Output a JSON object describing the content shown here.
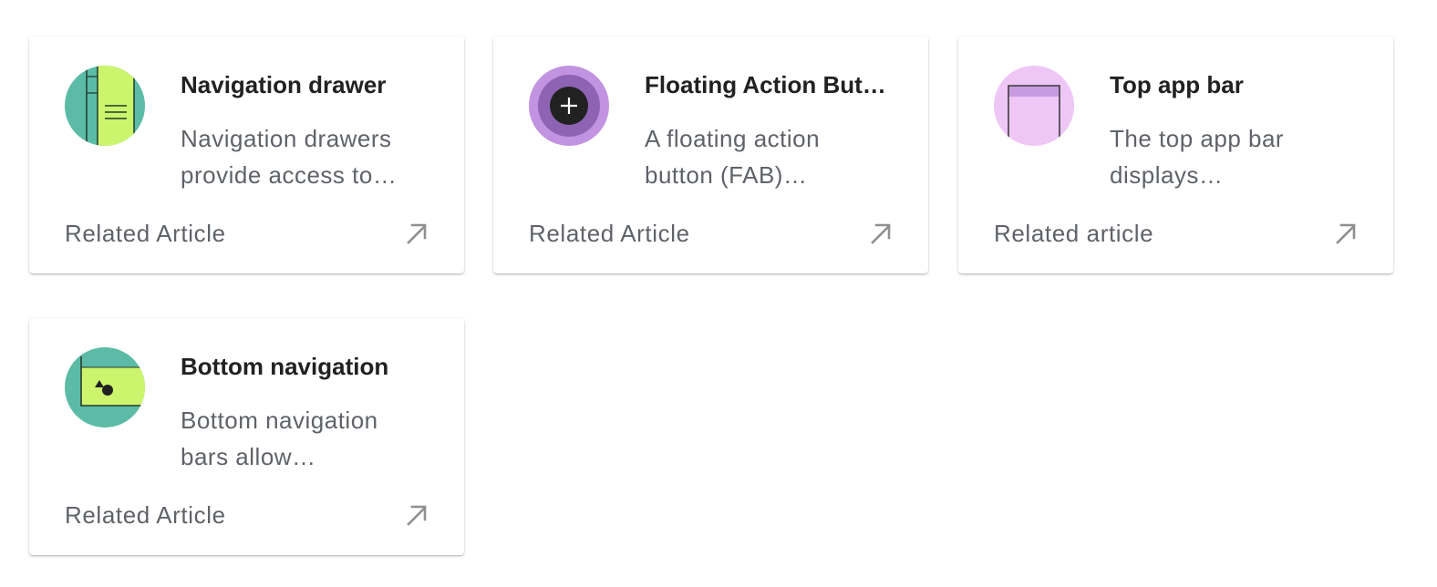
{
  "cards": [
    {
      "title": "Navigation drawer",
      "description": "Navigation drawers\nprovide access to…",
      "link_label": "Related Article",
      "icon": "navigation-drawer-thumbnail"
    },
    {
      "title": "Floating Action But…",
      "description": "A floating action\nbutton (FAB)…",
      "link_label": "Related Article",
      "icon": "fab-thumbnail"
    },
    {
      "title": "Top app bar",
      "description": "The top app bar\ndisplays…",
      "link_label": "Related article",
      "icon": "top-app-bar-thumbnail"
    },
    {
      "title": "Bottom navigation",
      "description": "Bottom navigation\nbars allow…",
      "link_label": "Related Article",
      "icon": "bottom-navigation-thumbnail"
    }
  ],
  "colors": {
    "teal": "#5bbba6",
    "lime": "#ccf56d",
    "purple_light": "#c293e0",
    "purple_dark": "#8e63b3",
    "pink": "#efc7f7",
    "pink_bar": "#c79be0",
    "arrow": "#8f8f8f"
  },
  "link_icon": "arrow-outward-icon"
}
